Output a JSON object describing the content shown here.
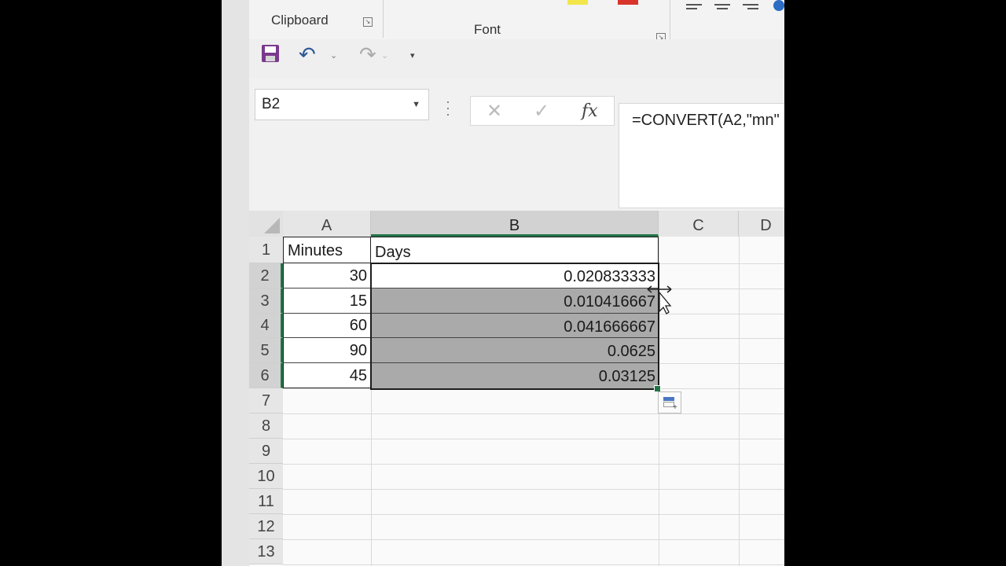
{
  "ribbon": {
    "groups": {
      "clipboard": "Clipboard",
      "font": "Font"
    }
  },
  "quick_access": {
    "save_icon": "save-icon",
    "undo_icon": "undo-icon",
    "redo_icon": "redo-icon",
    "customize_icon": "customize-qat-icon"
  },
  "formula_bar": {
    "name_box": "B2",
    "cancel_glyph": "✕",
    "enter_glyph": "✓",
    "fx_label": "fx",
    "formula": "=CONVERT(A2,\"mn\""
  },
  "sheet": {
    "columns": [
      "A",
      "B",
      "C",
      "D"
    ],
    "rows": [
      "1",
      "2",
      "3",
      "4",
      "5",
      "6",
      "7",
      "8",
      "9",
      "10",
      "11",
      "12",
      "13"
    ],
    "headers": {
      "A": "Minutes",
      "B": "Days"
    },
    "data": [
      {
        "minutes": "30",
        "days": "0.020833333"
      },
      {
        "minutes": "15",
        "days": "0.010416667"
      },
      {
        "minutes": "60",
        "days": "0.041666667"
      },
      {
        "minutes": "90",
        "days": "0.0625"
      },
      {
        "minutes": "45",
        "days": "0.03125"
      }
    ],
    "selected_range": "B2:B6",
    "active_cell": "B2"
  },
  "colors": {
    "accent": "#217346",
    "selection_fill": "#a9aaa9"
  }
}
